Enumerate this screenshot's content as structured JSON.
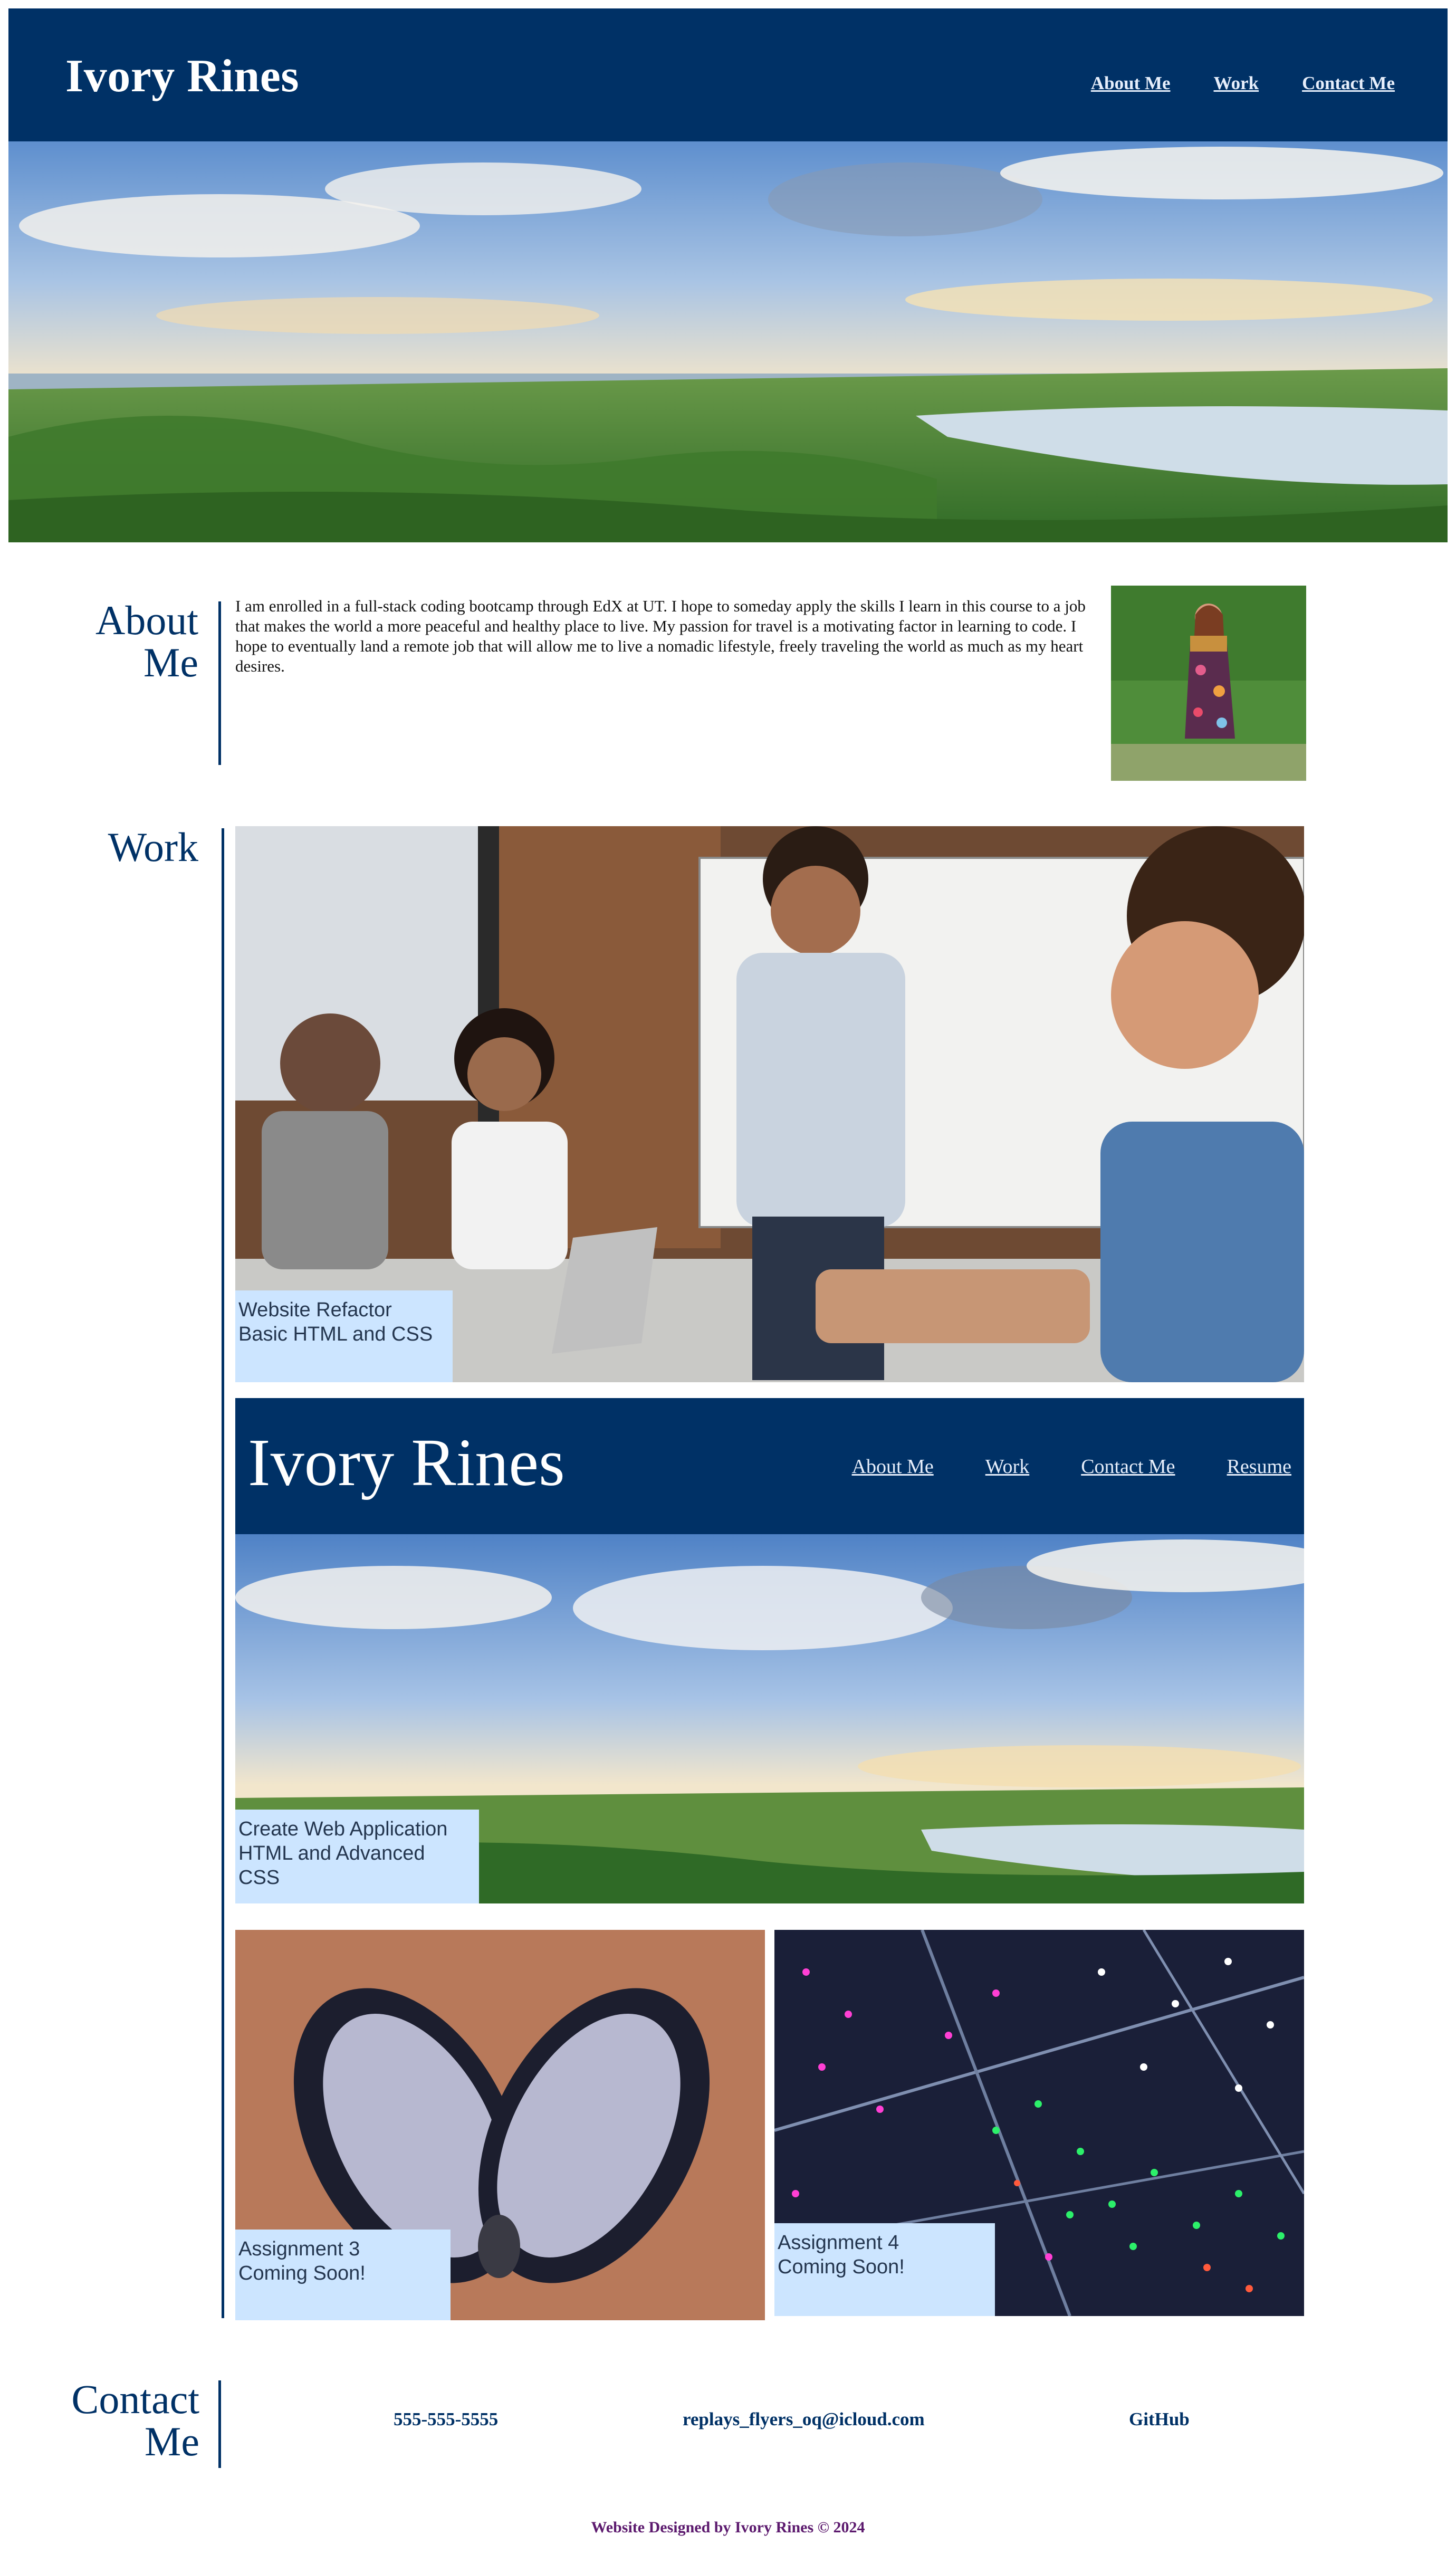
{
  "header": {
    "site_title": "Ivory Rines",
    "nav": {
      "about": "About Me",
      "work": "Work",
      "contact": "Contact Me"
    }
  },
  "about": {
    "heading_line1": "About",
    "heading_line2": "Me",
    "body": "I am enrolled in a full-stack coding bootcamp through EdX at UT. I hope to someday apply the skills I learn in this course to a job that makes the world a more peaceful and healthy place to live. My passion for travel is a motivating factor in learning to code. I hope to eventually land a remote job that will allow me to live a nomadic lifestyle, freely traveling the world as much as my heart desires."
  },
  "work": {
    "heading": "Work",
    "projects": [
      {
        "line1": "Website Refactor",
        "line2": "Basic HTML and CSS"
      },
      {
        "line1": "Create Web Application",
        "line2": "HTML and Advanced CSS",
        "preview": {
          "title": "Ivory Rines",
          "nav": [
            "About Me",
            "Work",
            "Contact Me",
            "Resume"
          ]
        }
      },
      {
        "line1": "Assignment 3",
        "line2": "Coming Soon!"
      },
      {
        "line1": "Assignment 4",
        "line2": "Coming Soon!"
      }
    ]
  },
  "contact": {
    "heading_line1": "Contact",
    "heading_line2": "Me",
    "phone": "555-555-5555",
    "email": "replays_flyers_oq@icloud.com",
    "github": "GitHub"
  },
  "footer": {
    "text": "Website Designed by Ivory Rines © 2024"
  },
  "colors": {
    "header_bg": "#003166",
    "label_bg": "#cce5ff",
    "footer_text": "#5c1a6e"
  }
}
